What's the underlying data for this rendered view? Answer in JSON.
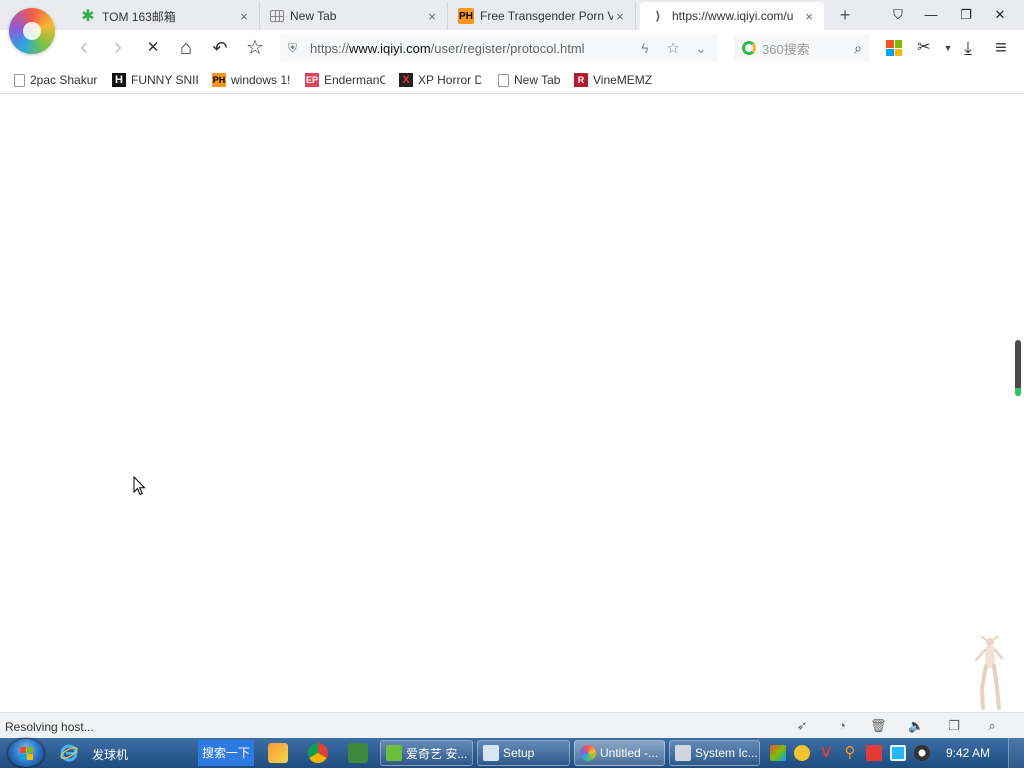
{
  "browser": {
    "tabs": [
      {
        "title": "TOM 163邮箱",
        "close": "×"
      },
      {
        "title": "New Tab",
        "close": "×"
      },
      {
        "title": "Free Transgender Porn Vi",
        "close": "×",
        "favicon_text": "PH"
      },
      {
        "title": "https://www.iqiyi.com/u",
        "close": "×",
        "active": true
      }
    ],
    "new_tab": "+",
    "window_controls": {
      "skin": "⛉",
      "minimize": "—",
      "restore": "❐",
      "close": "✕"
    }
  },
  "toolbar": {
    "back": "‹",
    "forward": "›",
    "stop": "✕",
    "home": "⌂",
    "undo": "↶",
    "favorite": "☆",
    "url_prefix": "https://",
    "url_host": "www.iqiyi.com",
    "url_path": "/user/register/protocol.html",
    "search_placeholder": "360搜索",
    "menu": "≡"
  },
  "bookmarks": [
    {
      "label": "2pac Shakur",
      "icon": "page-icon"
    },
    {
      "label": "FUNNY SNIP",
      "icon": "h-icon",
      "favicon_text": "H"
    },
    {
      "label": "windows 1!",
      "icon": "ph-icon",
      "favicon_text": "PH"
    },
    {
      "label": "EndermanC",
      "icon": "ep-icon",
      "favicon_text": "EP"
    },
    {
      "label": "XP Horror D",
      "icon": "xp-icon",
      "favicon_text": "X"
    },
    {
      "label": "New Tab",
      "icon": "page-icon"
    },
    {
      "label": "VineMEMZ",
      "icon": "vine-icon",
      "favicon_text": "R"
    }
  ],
  "status": {
    "text": "Resolving host..."
  },
  "taskbar": {
    "ie_label": "发球机",
    "search_button": "搜索一下",
    "tasks": [
      {
        "label": "爱奇艺 安..."
      },
      {
        "label": "Setup"
      },
      {
        "label": "Untitled -..."
      },
      {
        "label": "System Ic..."
      }
    ],
    "clock": "9:42 AM"
  },
  "colors": {
    "accent": "#2f7ae0",
    "taskbar": "#2a5b91",
    "scroll_indicator": "#35c06a"
  }
}
